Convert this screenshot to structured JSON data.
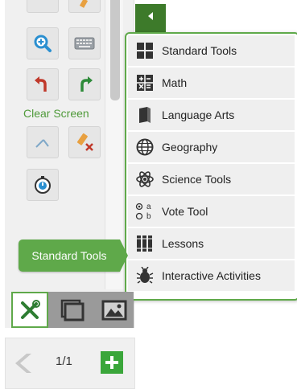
{
  "clear_screen_label": "Clear Screen",
  "tool_menu": {
    "items": [
      {
        "label": "Standard Tools",
        "icon": "standard-tools-icon"
      },
      {
        "label": "Math",
        "icon": "math-icon"
      },
      {
        "label": "Language Arts",
        "icon": "book-icon"
      },
      {
        "label": "Geography",
        "icon": "globe-icon"
      },
      {
        "label": "Science Tools",
        "icon": "atom-icon"
      },
      {
        "label": "Vote Tool",
        "icon": "vote-icon"
      },
      {
        "label": "Lessons",
        "icon": "lessons-icon"
      },
      {
        "label": "Interactive Activities",
        "icon": "bug-icon"
      }
    ],
    "vote_icon_glyphs": {
      "top": "a",
      "bottom": "b"
    }
  },
  "callout_label": "Standard Tools",
  "pager": {
    "text": "1/1"
  },
  "colors": {
    "accent": "#5fa94a",
    "dark_green": "#3d7a2a",
    "panel_bg": "#f0f0f0",
    "undo_red": "#c0392b",
    "redo_green": "#2e8b3a",
    "zoom_blue": "#2a8fd0"
  }
}
